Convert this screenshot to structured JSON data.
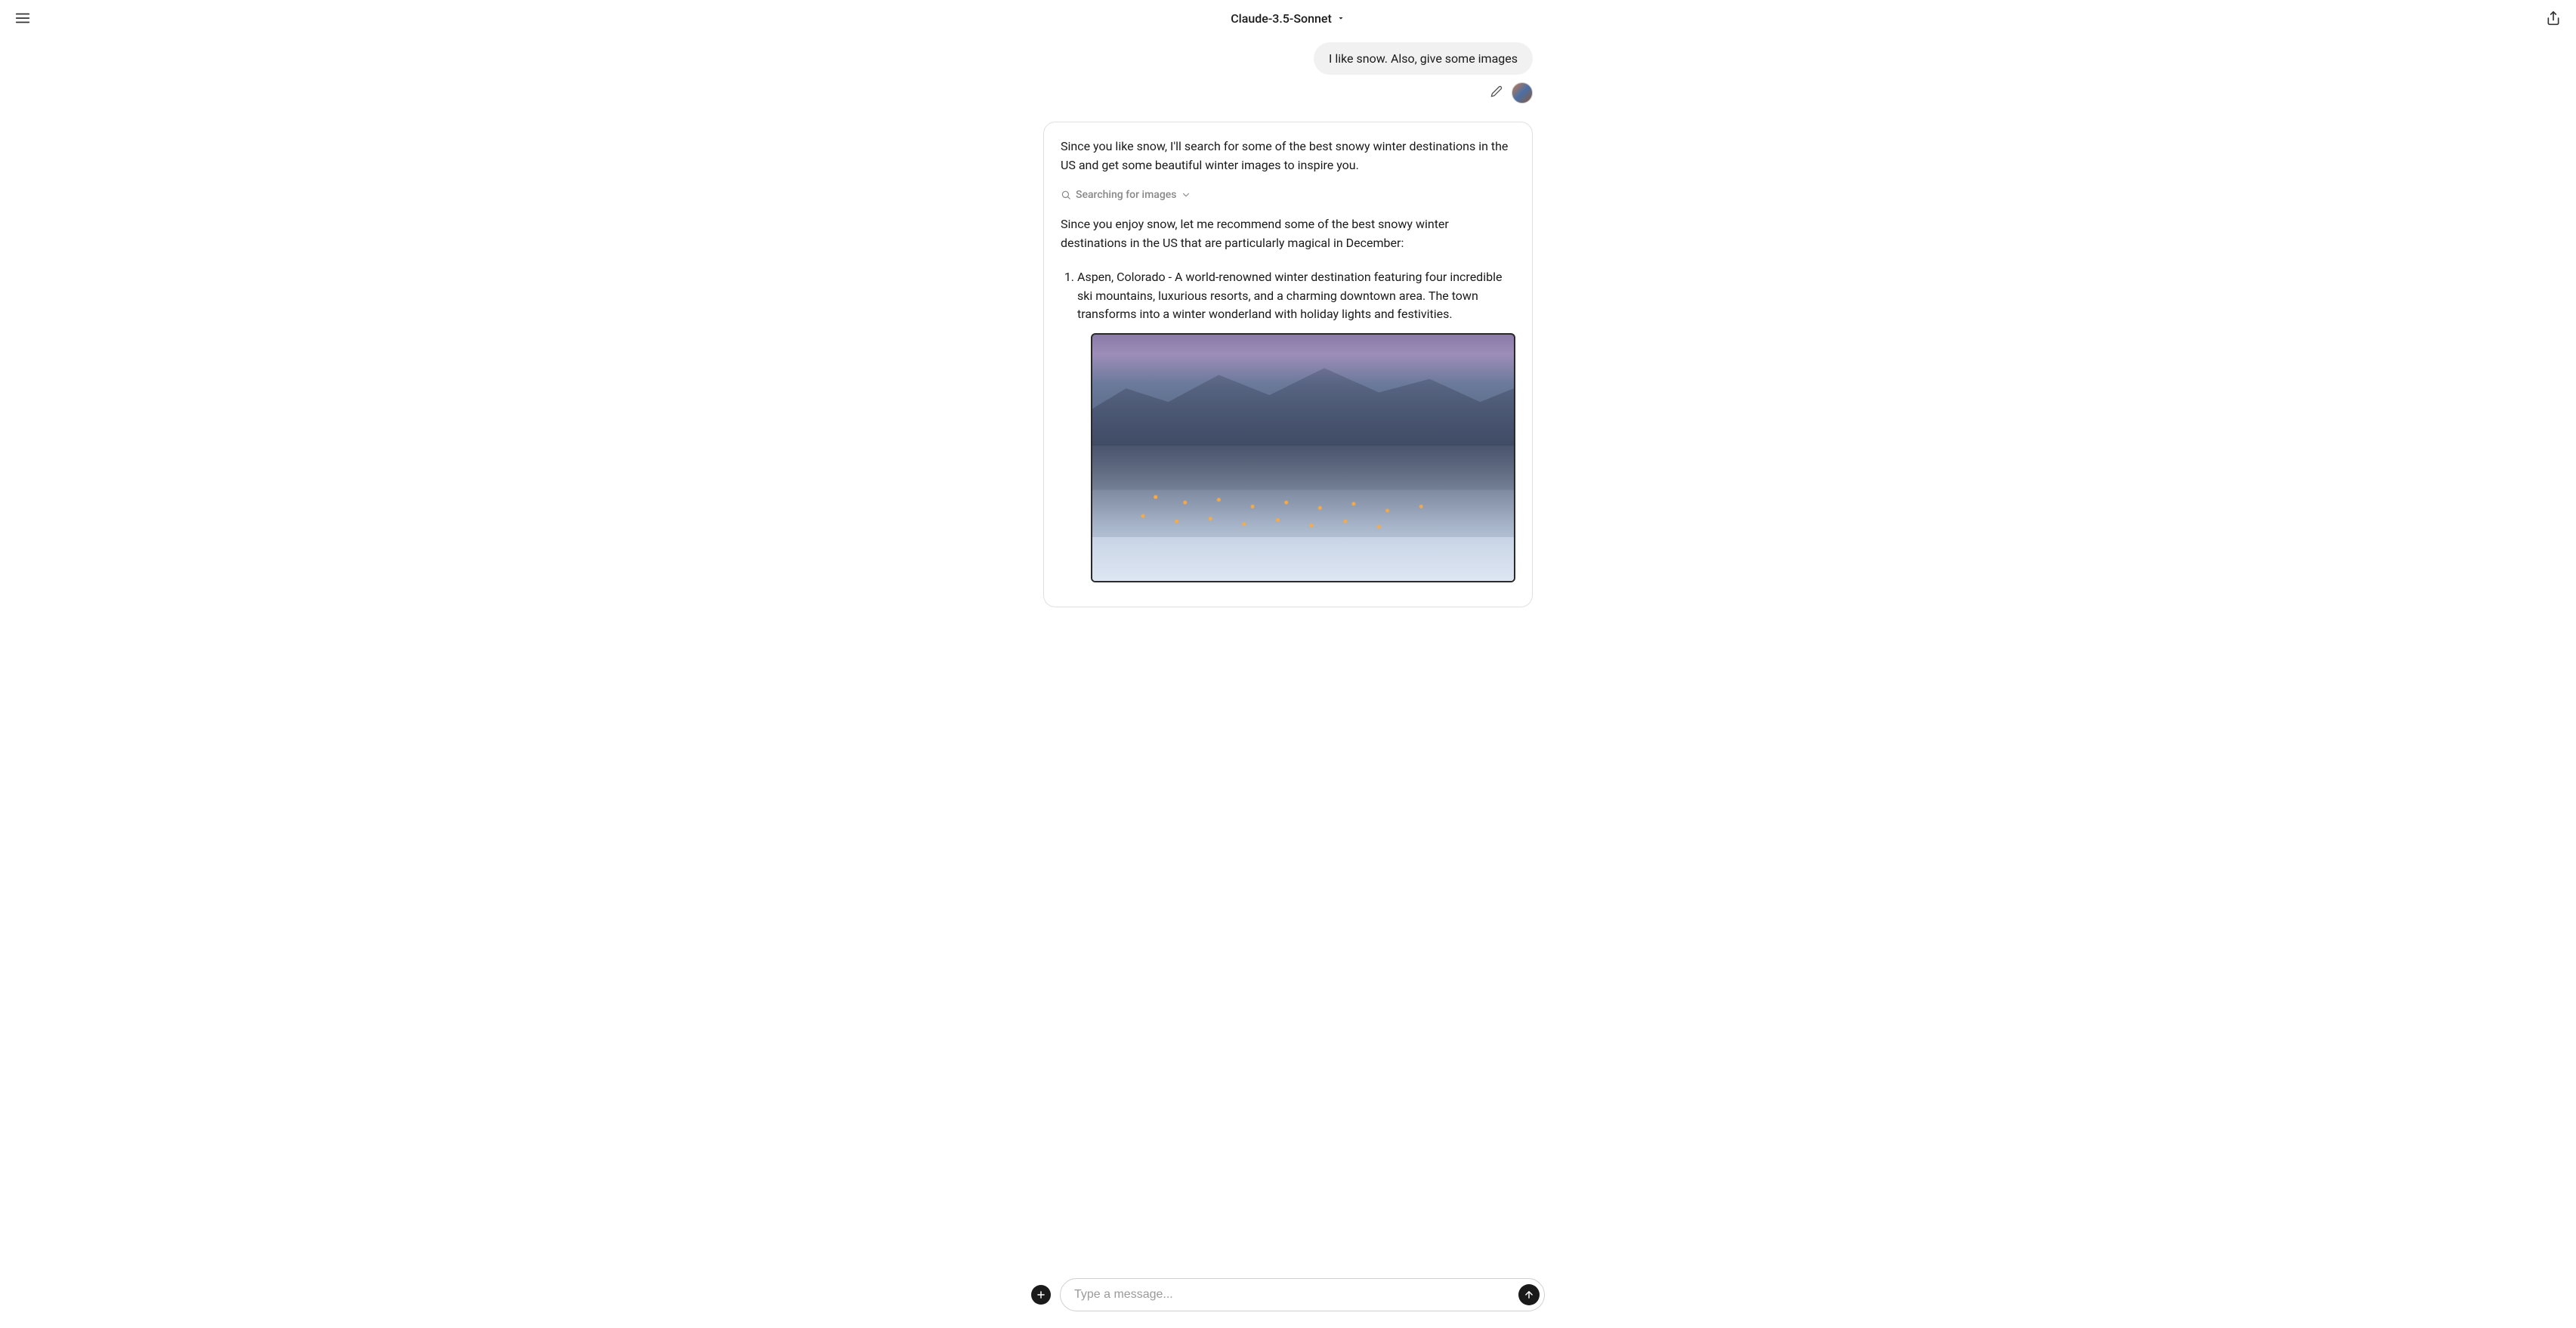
{
  "header": {
    "model_label": "Claude-3.5-Sonnet"
  },
  "conversation": {
    "user_message": "I like snow. Also, give some images",
    "assistant": {
      "intro": "Since you like snow, I'll search for some of the best snowy winter destinations in the US and get some beautiful winter images to inspire you.",
      "search_status": "Searching for images",
      "body": "Since you enjoy snow, let me recommend some of the best snowy winter destinations in the US that are particularly magical in December:",
      "list": [
        "Aspen, Colorado - A world-renowned winter destination featuring four incredible ski mountains, luxurious resorts, and a charming downtown area. The town transforms into a winter wonderland with holiday lights and festivities."
      ],
      "image_alt": "Aspen Colorado snowy town at dusk with mountains"
    }
  },
  "composer": {
    "placeholder": "Type a message...",
    "value": ""
  },
  "icons": {
    "menu": "menu-icon",
    "dropdown": "caret-down-icon",
    "share": "share-icon",
    "edit": "pencil-icon",
    "search": "magnifier-icon",
    "chevron": "chevron-down-icon",
    "plus": "plus-icon",
    "send": "arrow-up-icon"
  }
}
